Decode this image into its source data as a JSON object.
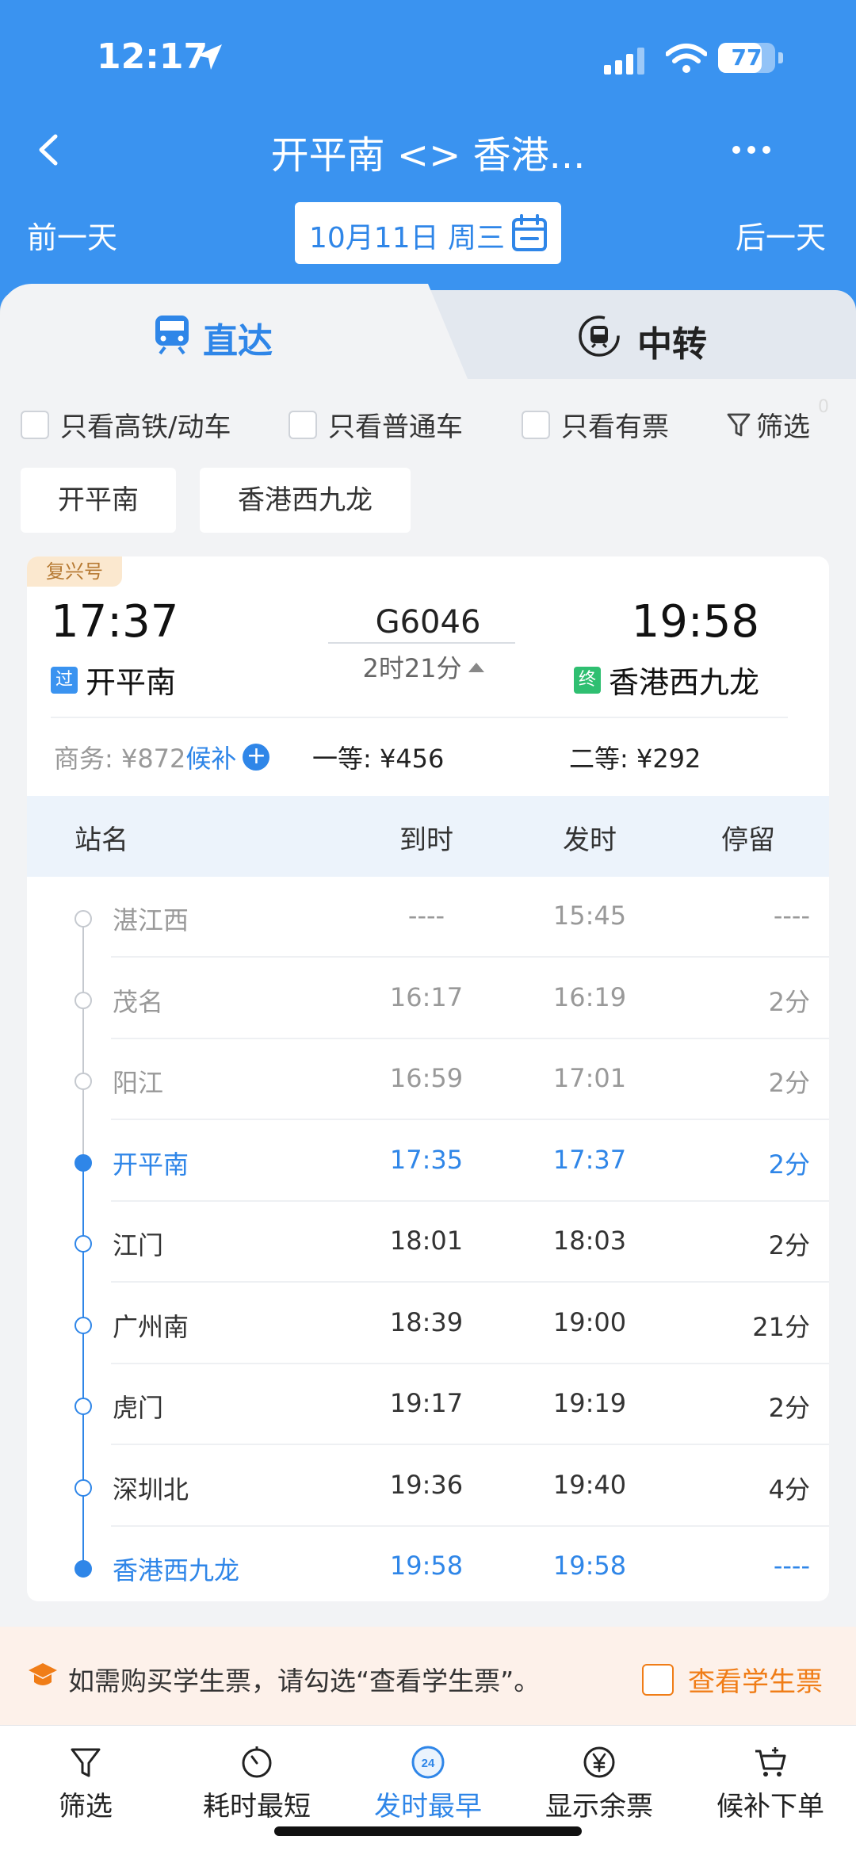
{
  "status_bar": {
    "time": "12:17",
    "battery": "77",
    "battery_level": 0.77
  },
  "nav": {
    "title": "开平南 <> 香港..."
  },
  "date_bar": {
    "prev": "前一天",
    "date": "10月11日 周三",
    "next": "后一天"
  },
  "tabs": {
    "direct": "直达",
    "transfer": "中转"
  },
  "filters": {
    "high_speed": "只看高铁/动车",
    "normal": "只看普通车",
    "available": "只看有票",
    "filter": "筛选",
    "filter_count": "0"
  },
  "station_buttons": [
    "开平南",
    "香港西九龙"
  ],
  "train": {
    "badge": "复兴号",
    "dep_time": "17:37",
    "arr_time": "19:58",
    "number": "G6046",
    "duration": "2时21分",
    "from_tag": "过",
    "from": "开平南",
    "to_tag": "终",
    "to": "香港西九龙",
    "price_business": "商务: ¥872",
    "waitlist": "候补",
    "price_first": "一等: ¥456",
    "price_second": "二等: ¥292"
  },
  "table": {
    "headers": {
      "station": "站名",
      "arrive": "到时",
      "depart": "发时",
      "stop": "停留"
    },
    "rows": [
      {
        "station": "湛江西",
        "arrive": "----",
        "depart": "15:45",
        "stop": "----",
        "state": "past"
      },
      {
        "station": "茂名",
        "arrive": "16:17",
        "depart": "16:19",
        "stop": "2分",
        "state": "past"
      },
      {
        "station": "阳江",
        "arrive": "16:59",
        "depart": "17:01",
        "stop": "2分",
        "state": "past"
      },
      {
        "station": "开平南",
        "arrive": "17:35",
        "depart": "17:37",
        "stop": "2分",
        "state": "board"
      },
      {
        "station": "江门",
        "arrive": "18:01",
        "depart": "18:03",
        "stop": "2分",
        "state": "normal"
      },
      {
        "station": "广州南",
        "arrive": "18:39",
        "depart": "19:00",
        "stop": "21分",
        "state": "normal"
      },
      {
        "station": "虎门",
        "arrive": "19:17",
        "depart": "19:19",
        "stop": "2分",
        "state": "normal"
      },
      {
        "station": "深圳北",
        "arrive": "19:36",
        "depart": "19:40",
        "stop": "4分",
        "state": "normal"
      },
      {
        "station": "香港西九龙",
        "arrive": "19:58",
        "depart": "19:58",
        "stop": "----",
        "state": "alight"
      }
    ]
  },
  "notice": {
    "text": "如需购买学生票，请勾选“查看学生票”。",
    "checkbox": "查看学生票"
  },
  "bottom_bar": {
    "filter": "筛选",
    "shortest": "耗时最短",
    "earliest": "发时最早",
    "earliest_badge": "24",
    "remaining": "显示余票",
    "waitlist": "候补下单"
  },
  "colors": {
    "header": "#3a93f0",
    "accent": "#2f86e8",
    "orange": "#f07d17"
  }
}
